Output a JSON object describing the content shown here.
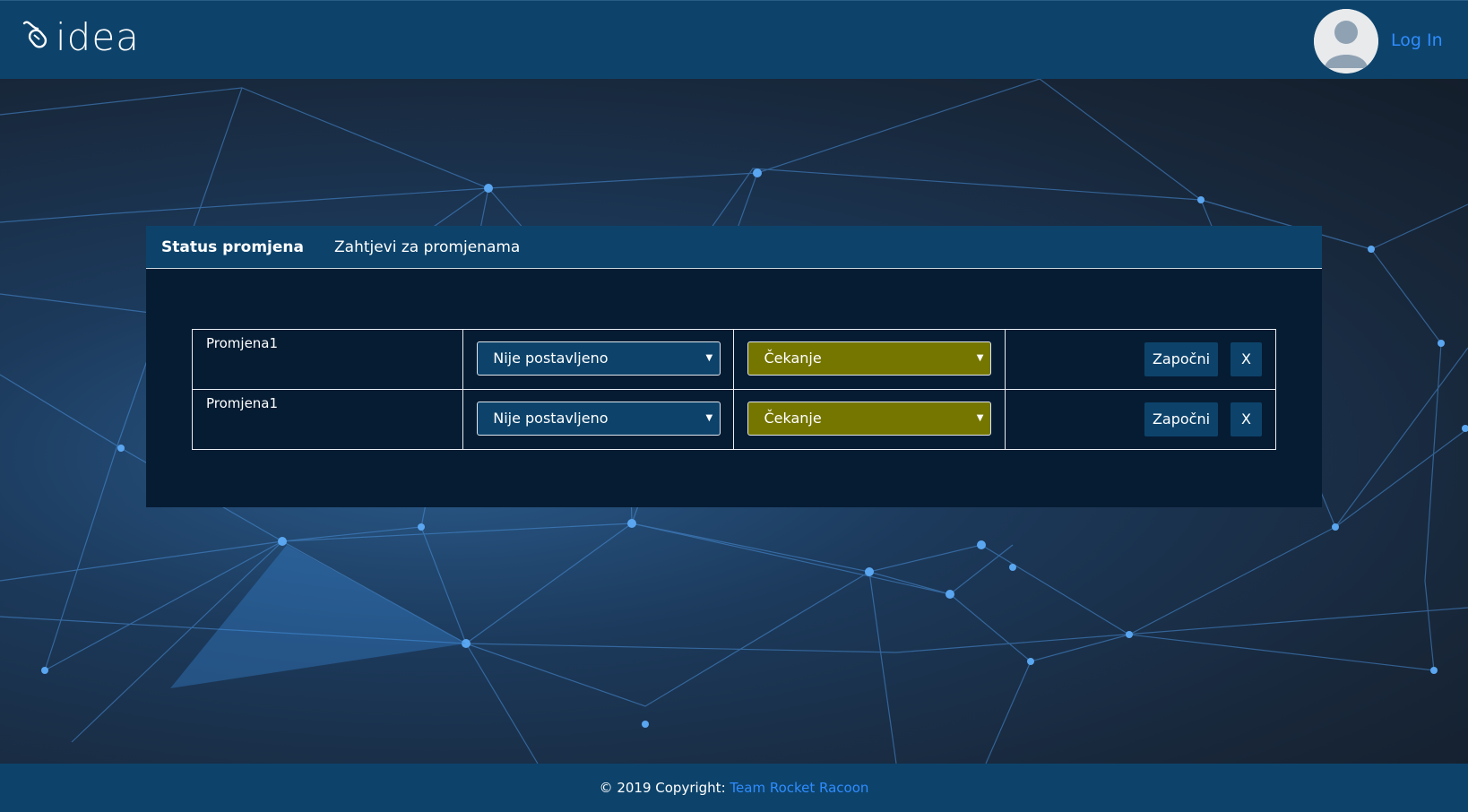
{
  "header": {
    "logo_text": "idea",
    "login_label": "Log In"
  },
  "tabs": [
    {
      "label": "Status promjena",
      "active": true
    },
    {
      "label": "Zahtjevi za promjenama",
      "active": false
    }
  ],
  "rows": [
    {
      "name": "Promjena1",
      "assignee": "Nije postavljeno",
      "status": "Čekanje",
      "start_label": "Započni",
      "remove_label": "X"
    },
    {
      "name": "Promjena1",
      "assignee": "Nije postavljeno",
      "status": "Čekanje",
      "start_label": "Započni",
      "remove_label": "X"
    }
  ],
  "footer": {
    "copyright": "© 2019 Copyright:",
    "team": "Team Rocket Racoon"
  },
  "colors": {
    "header_bg": "#0d436b",
    "panel_bg": "#061c33",
    "status_select_bg": "#757600",
    "link": "#2f8cff"
  }
}
